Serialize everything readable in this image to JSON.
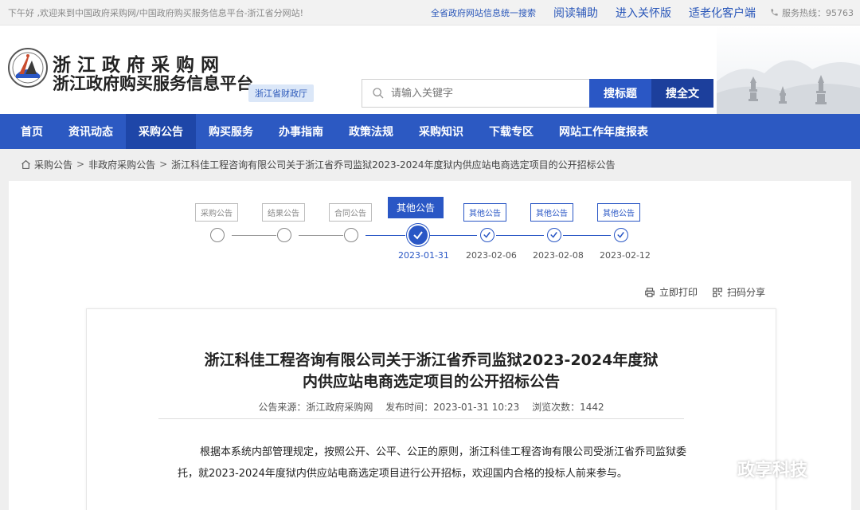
{
  "topbar": {
    "greeting": "下午好 ,欢迎来到中国政府采购网/中国政府购买服务信息平台-浙江省分网站!",
    "links": [
      "全省政府网站信息统一搜索",
      "阅读辅助",
      "进入关怀版",
      "适老化客户端"
    ],
    "hotline": "服务热线：95763"
  },
  "header": {
    "name_line1": "浙江政府采购网",
    "name_line2": "浙江政府购买服务信息平台",
    "dept": "浙江省财政厅",
    "search_placeholder": "请输入关键字",
    "btn_title": "搜标题",
    "btn_full": "搜全文"
  },
  "nav": {
    "items": [
      "首页",
      "资讯动态",
      "采购公告",
      "购买服务",
      "办事指南",
      "政策法规",
      "采购知识",
      "下载专区",
      "网站工作年度报表"
    ],
    "active_index": 2
  },
  "breadcrumb": {
    "items": [
      "采购公告",
      "非政府采购公告",
      "浙江科佳工程咨询有限公司关于浙江省乔司监狱2023-2024年度狱内供应站电商选定项目的公开招标公告"
    ]
  },
  "timeline": {
    "steps": [
      {
        "label": "采购公告",
        "date": "",
        "state": "inactive"
      },
      {
        "label": "结果公告",
        "date": "",
        "state": "inactive"
      },
      {
        "label": "合同公告",
        "date": "",
        "state": "inactive"
      },
      {
        "label": "其他公告",
        "date": "2023-01-31",
        "state": "active"
      },
      {
        "label": "其他公告",
        "date": "2023-02-06",
        "state": "done"
      },
      {
        "label": "其他公告",
        "date": "2023-02-08",
        "state": "done"
      },
      {
        "label": "其他公告",
        "date": "2023-02-12",
        "state": "done"
      }
    ]
  },
  "tools": {
    "print": "立即打印",
    "share": "扫码分享"
  },
  "article": {
    "title_line1": "浙江科佳工程咨询有限公司关于浙江省乔司监狱2023-2024年度狱",
    "title_line2": "内供应站电商选定项目的公开招标公告",
    "source": "公告来源：浙江政府采购网",
    "publish_time": "发布时间：2023-01-31 10:23",
    "views": "浏览次数：1442",
    "body": "根据本系统内部管理规定，按照公开、公平、公正的原则，浙江科佳工程咨询有限公司受浙江省乔司监狱委托，就2023-2024年度狱内供应站电商选定项目进行公开招标，欢迎国内合格的投标人前来参与。"
  },
  "watermark": "政享科技",
  "colors": {
    "primary": "#2c59c2",
    "primary_dark": "#1e46a8",
    "link": "#2a57b9"
  }
}
